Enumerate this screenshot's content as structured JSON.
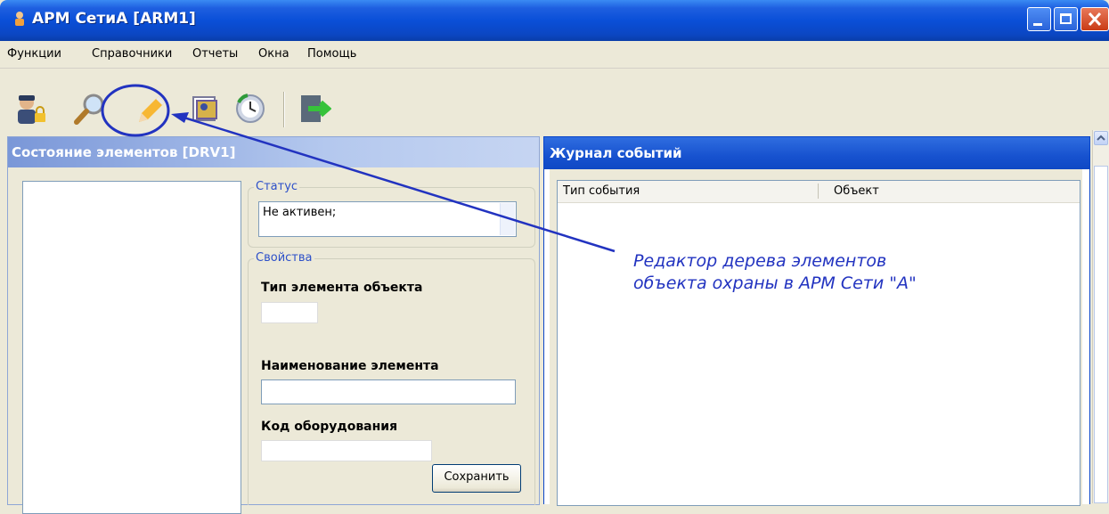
{
  "window": {
    "title": "АРМ СетиА [ARM1]"
  },
  "menu": [
    "Функции",
    "Справочники",
    "Отчеты",
    "Окна",
    "Помощь"
  ],
  "toolbar": {
    "icons": [
      "user-lock-icon",
      "search-icon",
      "pencil-icon",
      "image-icon",
      "clock-icon",
      "exit-icon"
    ],
    "highlighted": "pencil-icon"
  },
  "left_panel": {
    "title": "Состояние элементов [DRV1]",
    "status": {
      "legend": "Статус",
      "value": "Не активен;"
    },
    "properties": {
      "legend": "Свойства",
      "element_type_label": "Тип элемента объекта",
      "element_name_label": "Наименование элемента",
      "element_name_value": "",
      "equipment_code_label": "Код оборудования",
      "equipment_code_value": "",
      "save_button": "Сохранить"
    }
  },
  "right_panel": {
    "title": "Журнал событий",
    "columns": [
      "Тип события",
      "Объект"
    ]
  },
  "annotation": {
    "lines": [
      "Редактор дерева элементов",
      "объекта охраны в АРМ Сети \"А\""
    ],
    "color": "#2233c0"
  },
  "colors": {
    "xp_face": "#ECE9D8",
    "title_blue": "#0A4FD8",
    "legend_blue": "#2d50c9"
  }
}
